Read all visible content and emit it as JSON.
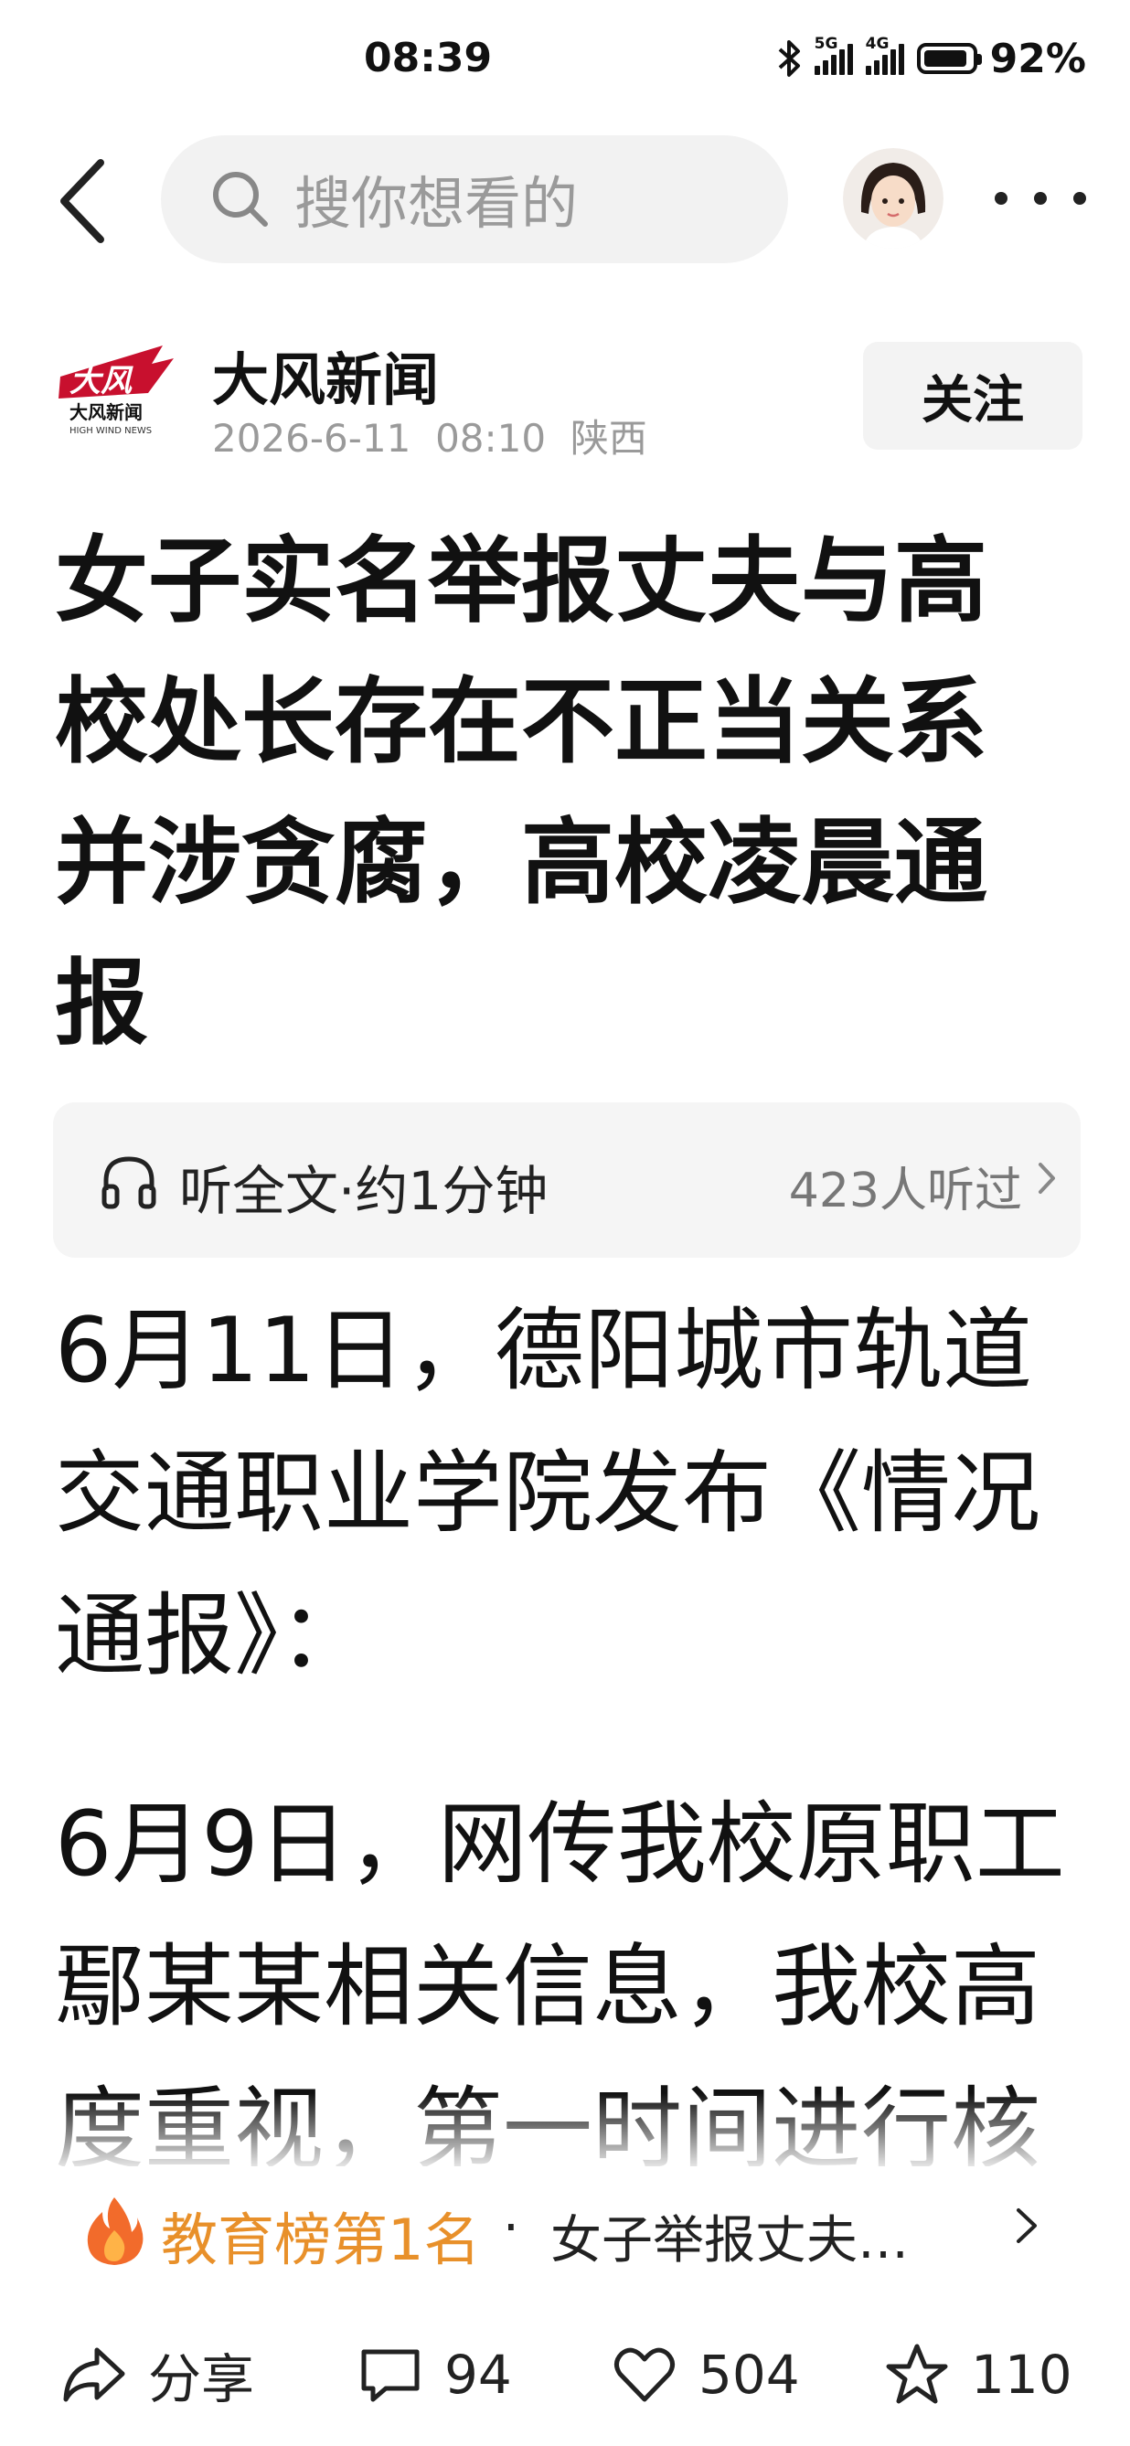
{
  "status_bar": {
    "time": "08:39",
    "network_1": "5G",
    "network_2": "4G",
    "battery": "92%",
    "battery_level": 0.92
  },
  "search": {
    "placeholder": "搜你想看的"
  },
  "author": {
    "logo_text": "大风",
    "logo_sub": "大风新闻",
    "logo_en": "HIGH WIND NEWS",
    "name": "大风新闻",
    "date": "2026-6-11",
    "time": "08:10",
    "location": "陕西",
    "follow_label": "关注"
  },
  "article": {
    "headline": "女子实名举报丈夫与高校处长存在不正当关系并涉贪腐，高校凌晨通报",
    "paragraphs": [
      "6月11日，德阳城市轨道交通职业学院发布《情况通报》：",
      "6月9日，网传我校原职工鄢某某相关信息，我校高度重视，第一时间进行核"
    ]
  },
  "listen": {
    "label": "听全文·约1分钟",
    "count": "423人听过"
  },
  "rank": {
    "name": "教育榜第1名",
    "separator": "·",
    "title": "女子举报丈夫…"
  },
  "actions": {
    "share_label": "分享",
    "comments": "94",
    "likes": "504",
    "favorites": "110"
  },
  "colors": {
    "rank_accent": "#e8902a",
    "logo_red": "#c8102e",
    "search_bg": "#f2f2f2"
  }
}
